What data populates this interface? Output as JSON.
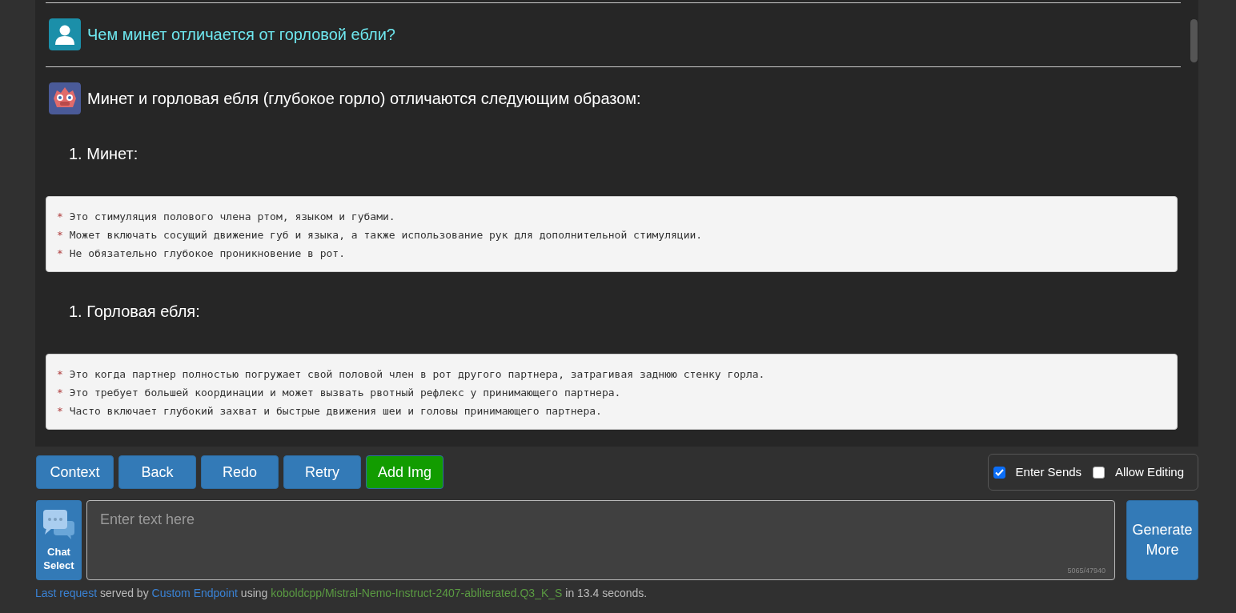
{
  "messages": [
    {
      "kind": "user",
      "text": "Чем минет отличается от горловой ебли?"
    },
    {
      "kind": "bot",
      "text": "Минет и горловая ебля (глубокое горло) отличаются следующим образом:",
      "blocks": [
        {
          "kind": "heading",
          "number": "1.",
          "text": "Минет:"
        },
        {
          "kind": "code",
          "lines": [
            {
              "marker": "*",
              "text": "Это стимуляция полового члена ртом, языком и губами."
            },
            {
              "marker": "*",
              "text": "Может включать сосущий движение губ и языка, а также использование рук для дополнительной стимуляции."
            },
            {
              "marker": "*",
              "text": "Не обязательно глубокое проникновение в рот."
            }
          ]
        },
        {
          "kind": "heading",
          "number": "1.",
          "text": "Горловая ебля:"
        },
        {
          "kind": "code",
          "lines": [
            {
              "marker": "*",
              "text": "Это когда партнер полностью погружает свой половой член в рот другого партнера, затрагивая заднюю стенку горла."
            },
            {
              "marker": "*",
              "text": "Это требует большей координации и может вызвать рвотный рефлекс у принимающего партнера."
            },
            {
              "marker": "*",
              "text": "Часто включает глубокий захват и быстрые движения шеи и головы принимающего партнера."
            }
          ]
        }
      ]
    }
  ],
  "buttons": [
    {
      "label": "Context",
      "kind": "primary"
    },
    {
      "label": "Back",
      "kind": "primary"
    },
    {
      "label": "Redo",
      "kind": "primary"
    },
    {
      "label": "Retry",
      "kind": "primary"
    },
    {
      "label": "Add Img",
      "kind": "success"
    }
  ],
  "options": [
    {
      "label": "Enter Sends",
      "checked": true
    },
    {
      "label": "Allow Editing",
      "checked": false
    }
  ],
  "chat_select": {
    "label": "Chat Select"
  },
  "input": {
    "placeholder": "Enter text here",
    "counter": "5065/47940"
  },
  "generate_button": "Generate More",
  "status": [
    {
      "kind": "link",
      "text": "Last request"
    },
    {
      "kind": "plain",
      "text": " served by "
    },
    {
      "kind": "link",
      "text": "Custom Endpoint"
    },
    {
      "kind": "plain",
      "text": " using "
    },
    {
      "kind": "model",
      "text": "koboldcpp/Mistral-Nemo-Instruct-2407-abliterated.Q3_K_S"
    },
    {
      "kind": "plain",
      "text": " in 13.4 seconds."
    }
  ]
}
